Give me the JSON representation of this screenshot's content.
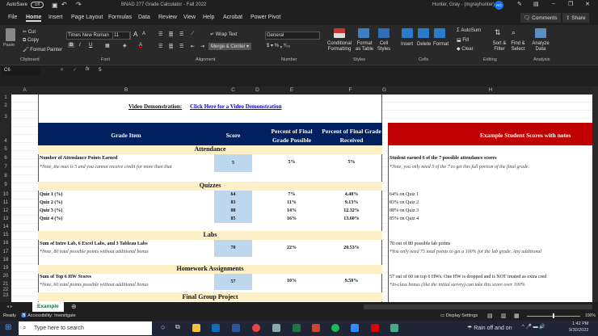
{
  "window": {
    "autosave": "AutoSave",
    "autosave_state": "Off",
    "title": "BNAD 277 Grade Calculator - Fall 2022",
    "user": "Hunter, Gray - (mgrayhunter)",
    "avatar": "HG"
  },
  "menu": [
    "File",
    "Home",
    "Insert",
    "Page Layout",
    "Formulas",
    "Data",
    "Review",
    "View",
    "Help",
    "Acrobat",
    "Power Pivot"
  ],
  "menu_right": {
    "comments": "Comments",
    "share": "Share"
  },
  "ribbon": {
    "clipboard": {
      "paste": "Paste",
      "cut": "Cut",
      "copy": "Copy",
      "format_painter": "Format Painter",
      "label": "Clipboard"
    },
    "font": {
      "name": "Times New Roman",
      "size": "11",
      "label": "Font"
    },
    "alignment": {
      "wrap": "Wrap Text",
      "merge": "Merge & Center",
      "label": "Alignment"
    },
    "number": {
      "format": "General",
      "label": "Number"
    },
    "styles": {
      "conditional": "Conditional Formatting",
      "format_table": "Format as Table",
      "cell_styles": "Cell Styles",
      "label": "Styles"
    },
    "cells": {
      "insert": "Insert",
      "delete": "Delete",
      "format": "Format",
      "label": "Cells"
    },
    "editing": {
      "autosum": "AutoSum",
      "fill": "Fill",
      "clear": "Clear",
      "sort": "Sort & Filter",
      "find": "Find & Select",
      "label": "Editing"
    },
    "analysis": {
      "analyze": "Analyze Data",
      "label": "Analysis"
    }
  },
  "formula_bar": {
    "name_box": "C6",
    "fx": "fx",
    "value": "5"
  },
  "columns": [
    "A",
    "B",
    "C",
    "D",
    "E",
    "F",
    "G",
    "H"
  ],
  "rows": [
    "1",
    "2",
    "3",
    "4",
    "5",
    "6",
    "7",
    "8",
    "9",
    "10",
    "11",
    "12",
    "13",
    "14",
    "15",
    "16",
    "17",
    "18",
    "19",
    "20",
    "21",
    "22",
    "23"
  ],
  "sheet": {
    "video_label": "Video Demonstration:",
    "video_link": "Click Here for a Video Demonstration",
    "headers": {
      "item": "Grade Item",
      "score": "Score",
      "possible": "Percent of Final Grade Possible",
      "received": "Percent of Final Grade Received",
      "example": "Example Student Scores with notes"
    },
    "sections": {
      "attendance": "Attendance",
      "quizzes": "Quizzes",
      "labs": "Labs",
      "homework": "Homework Assignments",
      "final": "Final Group Project"
    },
    "attendance": {
      "item": "Number of Attendance Points Earned",
      "note": "*Note, the max is 5 and you cannot receive credit for more than that",
      "score": "5",
      "possible": "5%",
      "received": "5%",
      "ex1": "Student earned 6 of the 7 possible attendance scores",
      "ex2": "*Note, you only need 5 of the 7 to get this full portion of the final grade."
    },
    "quizzes": [
      {
        "item": "Quiz 1 (%)",
        "score": "64",
        "possible": "7%",
        "received": "4.48%",
        "ex": "64% on Quiz 1"
      },
      {
        "item": "Quiz 2 (%)",
        "score": "83",
        "possible": "11%",
        "received": "9.13%",
        "ex": "83% on Quiz 2"
      },
      {
        "item": "Quiz 3 (%)",
        "score": "88",
        "possible": "14%",
        "received": "12.32%",
        "ex": "88% on Quiz 3"
      },
      {
        "item": "Quiz 4 (%)",
        "score": "85",
        "possible": "16%",
        "received": "13.60%",
        "ex": "85% on Quiz 4"
      }
    ],
    "labs": {
      "item": "Sum of Intro Lab, 6 Excel Labs, and 3 Tableau Labs",
      "note": "*Note, 80 total possible points without additional bonus",
      "score": "70",
      "possible": "22%",
      "received": "20.53%",
      "ex1": "70 out of 80 possible lab points",
      "ex2": "*You only need 75 total points to get a 100% for the lab grade. Any additional"
    },
    "homework": {
      "item": "Sum of Top 6 HW Scores",
      "note": "*Note, 60 total points possible without additional bonus",
      "score": "57",
      "possible": "10%",
      "received": "9.50%",
      "ex1": "57 out of 60 on top 6 HWs. One HW is dropped and is NOT treated as extra cred",
      "ex2": "*In-class bonus (like the initial survey) can take this score over 100%"
    }
  },
  "sheet_tabs": [
    "Example"
  ],
  "status": {
    "ready": "Ready",
    "accessibility": "Accessibility: Investigate",
    "display": "Display Settings",
    "zoom": "100%"
  },
  "taskbar": {
    "search": "Type here to search",
    "weather": "Rain off and on",
    "time": "1:42 PM",
    "date": "9/30/2022"
  },
  "colors": {
    "navy": "#002060",
    "red": "#c00000",
    "section": "#fdf0c8",
    "score": "#bdd7ee",
    "link": "#0000ee"
  }
}
